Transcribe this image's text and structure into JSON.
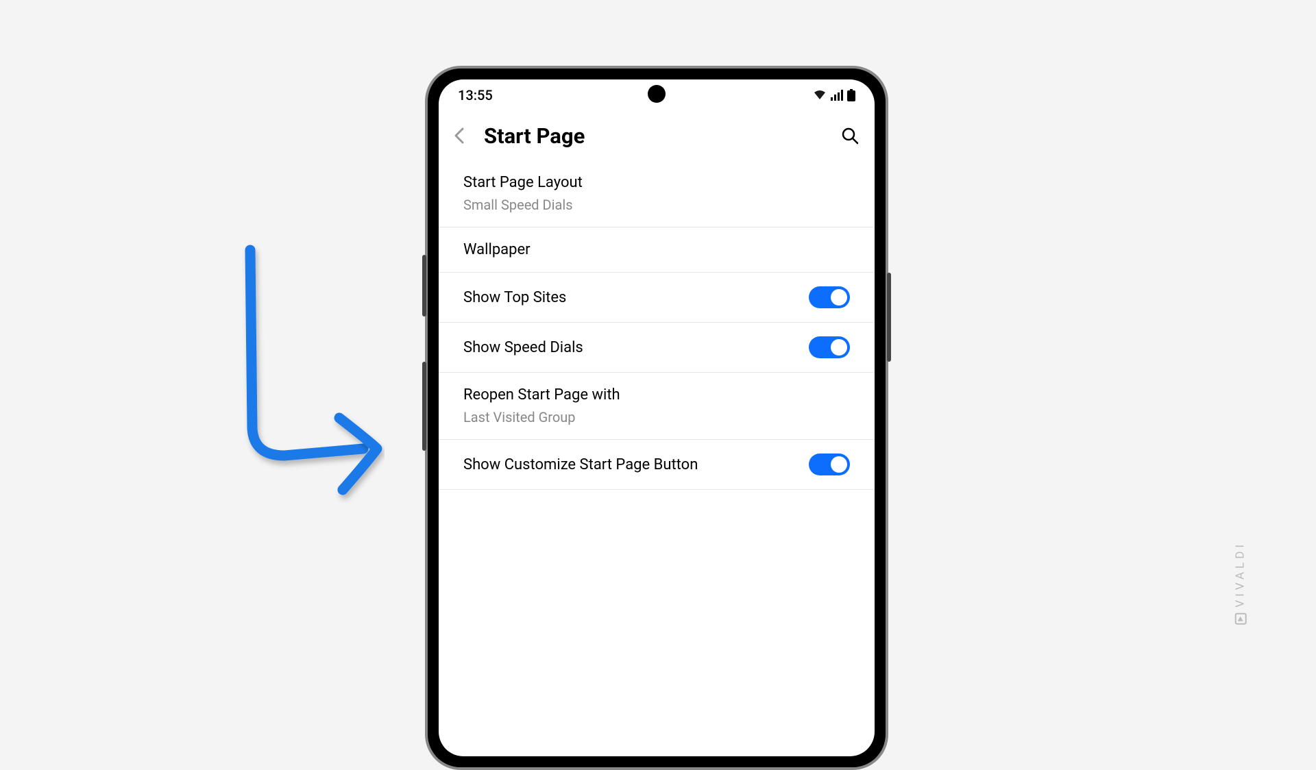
{
  "statusBar": {
    "time": "13:55"
  },
  "header": {
    "title": "Start Page"
  },
  "settings": {
    "layout": {
      "label": "Start Page Layout",
      "value": "Small Speed Dials"
    },
    "wallpaper": {
      "label": "Wallpaper"
    },
    "topSites": {
      "label": "Show Top Sites",
      "enabled": true
    },
    "speedDials": {
      "label": "Show Speed Dials",
      "enabled": true
    },
    "reopen": {
      "label": "Reopen Start Page with",
      "value": "Last Visited Group"
    },
    "customizeButton": {
      "label": "Show Customize Start Page Button",
      "enabled": true
    }
  },
  "watermark": {
    "text": "VIVALDI"
  }
}
